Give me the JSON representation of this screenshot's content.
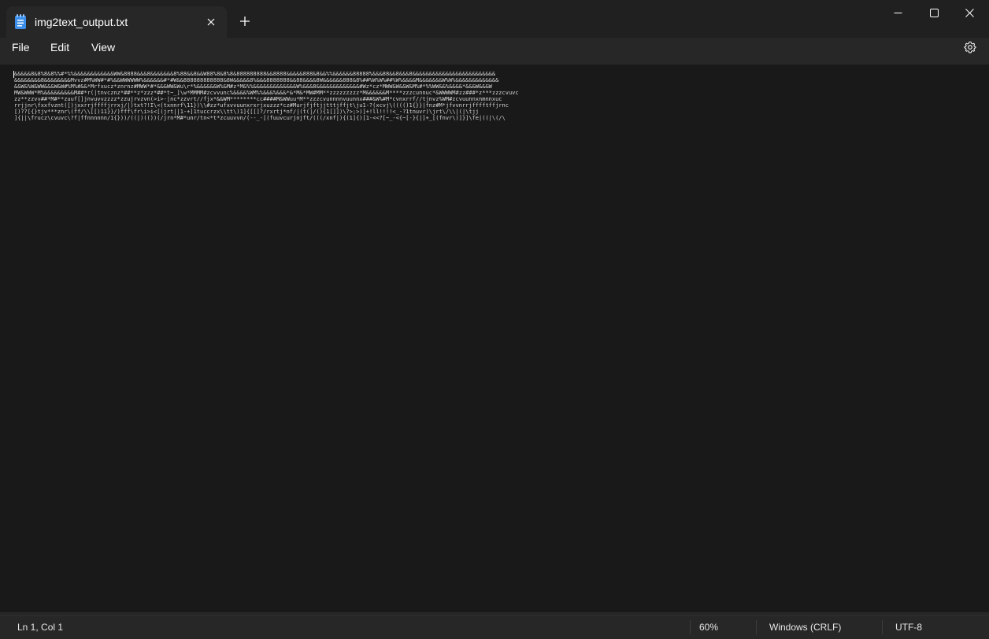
{
  "window": {
    "tab_title": "img2text_output.txt",
    "tab_icon": "notepad-icon",
    "new_tab_symbol": "+",
    "controls": [
      "minimize-icon",
      "maximize-icon",
      "close-icon"
    ]
  },
  "menu": {
    "items": [
      "File",
      "Edit",
      "View"
    ],
    "settings_icon": "gear-icon"
  },
  "editor": {
    "zoom_percent": 60,
    "lines": [
      "&&&&&8&8%8&8%%#*%%&&&&&&&&&&&&WW&8888&&&8&&&&&&&8%88&&8&&W88%8&8%8&888888888&&8888&&&&&888&8&&%%&&&&&&88888%&&&88&&8&&&8&&&&&&&&&&&&&&&&&&&&&&&&&",
      "&&&&&&&&8&&&&&&&&Mvvz#M%WW#*#%&&WWWWWW%&&&&&&#*#W&&888888888888&8W&&&&&8%&&&8888888&&88&&&&8W&&&&&&888&8%##%W%W%##%W%&&&&M&&&&&&&W%W%&&&&&&&&&&&&&",
      "&&W&%W&WW&&&W&W#%M%#&&*Mrfxucz*znrnz#MWW*#*&&&WW&Wu\\r*%&&&&&&W%&M#z*M&%%&&&&&&&&&&&&&W%&&&8&&&&&&&&&&&&&#Wz*cz*MWW&W&&W&M%#*%%WW&&%&&&&*&&&W&&&W",
      "MW&WWW*M%&&&&&&&&&M##*r(|tnvcznz*##**z*zzz*##*t~_]\\w*MMMM#zcvvunc%&&&&%WM%%&&&%&&&*&*M&*MW#MM**zzzzzzzzz*M&&&&&&M****zzzcunnuc*&WWWWM#zz###*z***zzzcvuvc",
      "zz**zzvv##*M#**zuuf[]jnvuvvzzzz*zzujrvzvn(>i>-|nc*zzvrt//fjx*&&WM********cc####M&WWuu*M**zzzcvunnnnvuunnx###&W%#M*cvnxrrf//tjnvz%WM#zcvuunnxnmnnxuc",
      "rrjjnr\\fxxfvznt([)jxxrrjffffjrrxj/|)txt?!I\\<(txnnrf\\11})\\\\#zz*ufxvvuunxrxrjxuzzz*cz#Murjfjftjjtttjffjt\\ju1-?(xcvj\\(((()1{}}|fnz#M*jfvvnrrjfffftffjrnc",
      "[)??[{}tjv***znr\\(ff/\\\\[[)11}}/)fff\\fr\\i>i<[(jrt||1-+]1tuccrzx\\\\tt\\)1]{[[]?/rxrtj*nf/|(t(|/(){1[]])\\?>;>)]+!ll!!!!<_-?1tnuvr)\\jrt\\/\\\\|(|\\tjj",
      "]{||\\frucz\\cvuvc\\?f|ffnnnnnn/1{}))/((|)(())(/jrn*M#*unr/tn<*t*zcuuvvn/(--_-[(fuuvcurjnjft/(((/xnf|){(1]{)[1-<<?[~_-<{~[-}{|]+_[(fnvr\\)]}]\\fe|((|\\(/\\"
    ]
  },
  "status": {
    "position": "Ln 1, Col 1",
    "zoom": "60%",
    "line_ending": "Windows (CRLF)",
    "encoding": "UTF-8"
  },
  "colors": {
    "titlebar": "#202020",
    "menubar": "#272727",
    "editor_bg": "#191919",
    "text": "#d6d6d6",
    "status_text": "#e6e6e6"
  }
}
